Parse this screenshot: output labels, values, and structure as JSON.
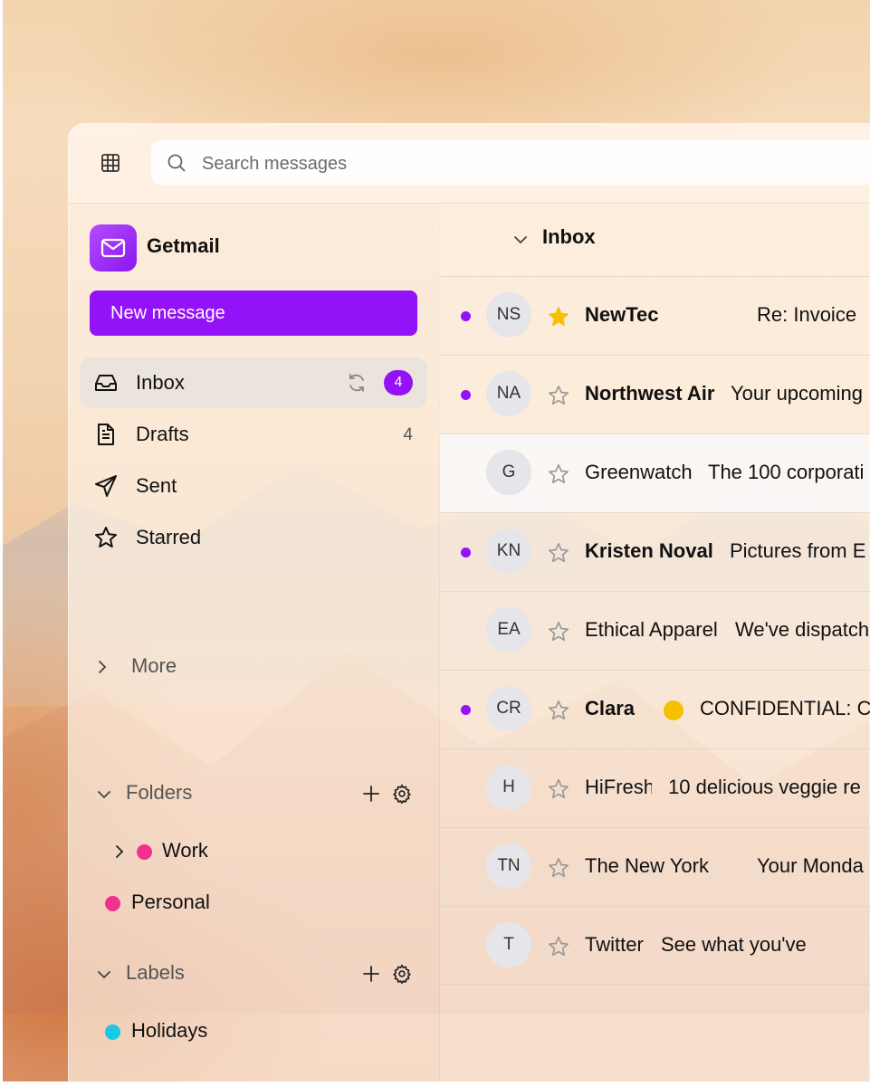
{
  "colors": {
    "accent": "#9312f7",
    "starred": "#f5c000",
    "work_folder": "#f0328c",
    "personal_folder": "#f0328c",
    "holidays_label": "#19c8e6",
    "unread_dot": "#9312f7"
  },
  "topbar": {
    "apps_icon": "grid-icon",
    "search": {
      "placeholder": "Search messages",
      "value": ""
    }
  },
  "brand": {
    "name": "Getmail",
    "logo_icon": "mail-icon"
  },
  "new_message_label": "New message",
  "nav": [
    {
      "id": "inbox",
      "label": "Inbox",
      "icon": "inbox-icon",
      "badge": "4",
      "active": true
    },
    {
      "id": "drafts",
      "label": "Drafts",
      "icon": "file-icon",
      "count": "4"
    },
    {
      "id": "sent",
      "label": "Sent",
      "icon": "send-icon"
    },
    {
      "id": "starred",
      "label": "Starred",
      "icon": "star-icon"
    }
  ],
  "more_label": "More",
  "folders": {
    "title": "Folders",
    "items": [
      {
        "label": "Work",
        "color": "#f0328c",
        "expandable": true
      },
      {
        "label": "Personal",
        "color": "#f0328c"
      }
    ]
  },
  "labels": {
    "title": "Labels",
    "items": [
      {
        "label": "Holidays",
        "color": "#19c8e6"
      }
    ]
  },
  "inbox_title": "Inbox",
  "messages": [
    {
      "initials": "NS",
      "sender": "NewTec",
      "subject": "Re: Invoice",
      "unread": true,
      "starred": true
    },
    {
      "initials": "NA",
      "sender": "Northwest Air",
      "subject": "Your upcoming",
      "unread": true,
      "starred": false
    },
    {
      "initials": "G",
      "sender": "Greenwatch",
      "subject": "The 100 corporati",
      "unread": false,
      "starred": false
    },
    {
      "initials": "KN",
      "sender": "Kristen Noval",
      "subject": "Pictures from E",
      "unread": true,
      "starred": false
    },
    {
      "initials": "EA",
      "sender": "Ethical Apparel",
      "subject": "We've dispatch",
      "unread": false,
      "starred": false
    },
    {
      "initials": "CR",
      "sender": "Clara",
      "subject": "CONFIDENTIAL: C",
      "unread": true,
      "starred": false,
      "label_color": "#f5c000"
    },
    {
      "initials": "H",
      "sender": "HiFresh",
      "subject": "10 delicious veggie re",
      "unread": false,
      "starred": false
    },
    {
      "initials": "TN",
      "sender": "The New York",
      "subject": "Your Monda",
      "unread": false,
      "starred": false
    },
    {
      "initials": "T",
      "sender": "Twitter",
      "subject": "See what you've",
      "unread": false,
      "starred": false
    }
  ]
}
